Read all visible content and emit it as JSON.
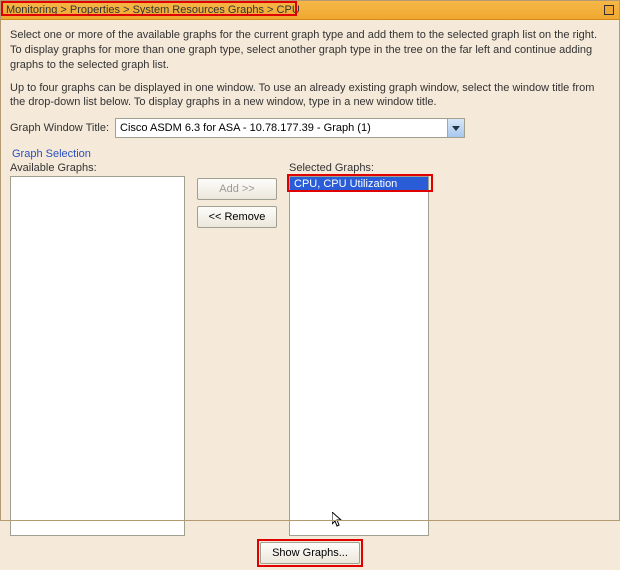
{
  "titlebar": {
    "breadcrumb": "Monitoring > Properties > System Resources Graphs > CPU"
  },
  "instructions": {
    "p1": "Select one or more of the available graphs for the current graph type and add them to the selected graph list on the right. To display graphs for more than one graph type, select another graph type in the tree on the far left and continue adding graphs to the selected graph list.",
    "p2": "Up to four graphs can be displayed in one window. To use an already existing graph window, select the window title from the drop-down list below. To display graphs in a new window, type in a new window title."
  },
  "graph_window": {
    "label": "Graph Window Title:",
    "value": "Cisco ASDM 6.3 for ASA - 10.78.177.39 - Graph (1)"
  },
  "section_label": "Graph Selection",
  "available": {
    "label": "Available Graphs:",
    "items": []
  },
  "buttons": {
    "add": "Add >>",
    "remove": "<< Remove",
    "show": "Show Graphs..."
  },
  "selected": {
    "label": "Selected Graphs:",
    "items": [
      "CPU, CPU Utilization"
    ],
    "selected_index": 0
  }
}
